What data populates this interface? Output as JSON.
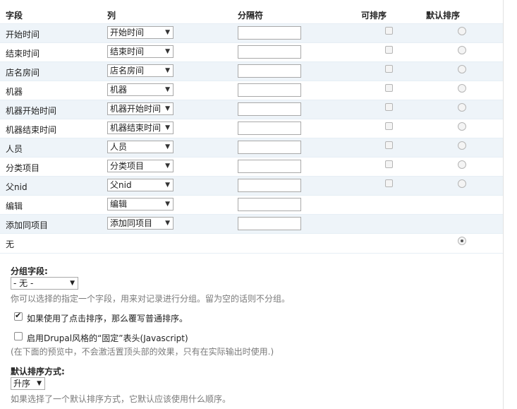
{
  "header": {
    "field": "字段",
    "column": "列",
    "separator": "分隔符",
    "sortable": "可排序",
    "default_sort": "默认排序"
  },
  "rows": [
    {
      "field": "开始时间",
      "column": "开始时间",
      "has_sep": true,
      "has_sortable": true,
      "has_default": true
    },
    {
      "field": "结束时间",
      "column": "结束时间",
      "has_sep": true,
      "has_sortable": true,
      "has_default": true
    },
    {
      "field": "店名房间",
      "column": "店名房间",
      "has_sep": true,
      "has_sortable": true,
      "has_default": true
    },
    {
      "field": "机器",
      "column": "机器",
      "has_sep": true,
      "has_sortable": true,
      "has_default": true
    },
    {
      "field": "机器开始时间",
      "column": "机器开始时间",
      "has_sep": true,
      "has_sortable": true,
      "has_default": true
    },
    {
      "field": "机器结束时间",
      "column": "机器结束时间",
      "has_sep": true,
      "has_sortable": true,
      "has_default": true
    },
    {
      "field": "人员",
      "column": "人员",
      "has_sep": true,
      "has_sortable": true,
      "has_default": true
    },
    {
      "field": "分类项目",
      "column": "分类项目",
      "has_sep": true,
      "has_sortable": true,
      "has_default": true
    },
    {
      "field": "父nid",
      "column": "父nid",
      "has_sep": true,
      "has_sortable": true,
      "has_default": true
    },
    {
      "field": "编辑",
      "column": "编辑",
      "has_sep": true,
      "has_sortable": false,
      "has_default": false
    },
    {
      "field": "添加同项目",
      "column": "添加同项目",
      "has_sep": true,
      "has_sortable": false,
      "has_default": false
    },
    {
      "field": "无",
      "column": null,
      "has_sep": false,
      "has_sortable": false,
      "has_default": true,
      "default_checked": true
    }
  ],
  "grouping": {
    "label": "分组字段:",
    "selected": "- 无 -",
    "description": "你可以选择的指定一个字段，用来对记录进行分组。留为空的话则不分组。"
  },
  "override_sort": {
    "checked": true,
    "label": "如果使用了点击排序，那么覆写普通排序。"
  },
  "sticky_header": {
    "checked": false,
    "label": "启用Drupal风格的“固定”表头(Javascript)",
    "description": "(在下面的预览中，不会激活置顶头部的效果，只有在实际输出时使用.)"
  },
  "default_sort_order": {
    "label": "默认排序方式:",
    "selected": "升序",
    "description": "如果选择了一个默认排序方式，它默认应该使用什么顺序。"
  },
  "icons": {
    "dropdown": "▼"
  }
}
